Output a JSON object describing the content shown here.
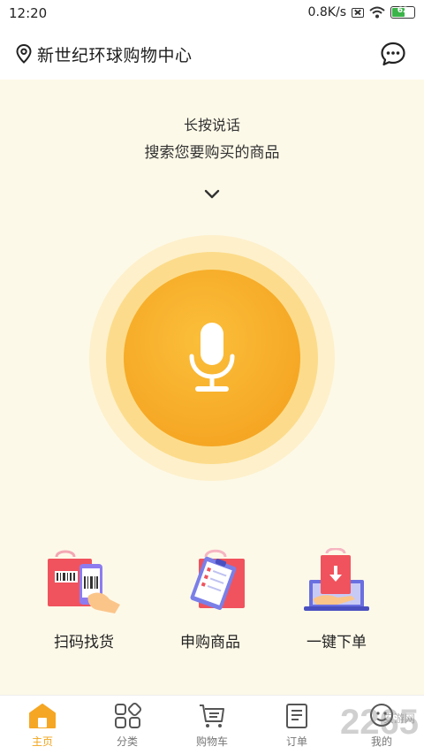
{
  "status_bar": {
    "time": "12:20",
    "network_speed": "0.8K/s",
    "battery_level": "62",
    "battery_fraction": 0.62
  },
  "header": {
    "location": "新世纪环球购物中心",
    "location_icon": "location-pin-icon",
    "message_icon": "chat-bubble-icon"
  },
  "voice": {
    "hint_line_1": "长按说话",
    "hint_line_2": "搜索您要购买的商品",
    "mic_icon": "microphone-icon"
  },
  "actions": [
    {
      "label": "扫码找货",
      "icon": "scan-barcode-bag-icon"
    },
    {
      "label": "申购商品",
      "icon": "purchase-request-bag-icon"
    },
    {
      "label": "一键下单",
      "icon": "one-click-order-bag-icon"
    }
  ],
  "nav": [
    {
      "label": "主页",
      "icon": "home-icon",
      "active": true
    },
    {
      "label": "分类",
      "icon": "category-icon",
      "active": false
    },
    {
      "label": "购物车",
      "icon": "cart-icon",
      "active": false
    },
    {
      "label": "订单",
      "icon": "order-icon",
      "active": false
    },
    {
      "label": "我的",
      "icon": "profile-icon",
      "active": false
    }
  ],
  "watermark": {
    "logo": "2265",
    "site": "安游网"
  },
  "colors": {
    "accent": "#f5a623",
    "background": "#fdf9e8",
    "active_nav": "#f0a51d"
  }
}
